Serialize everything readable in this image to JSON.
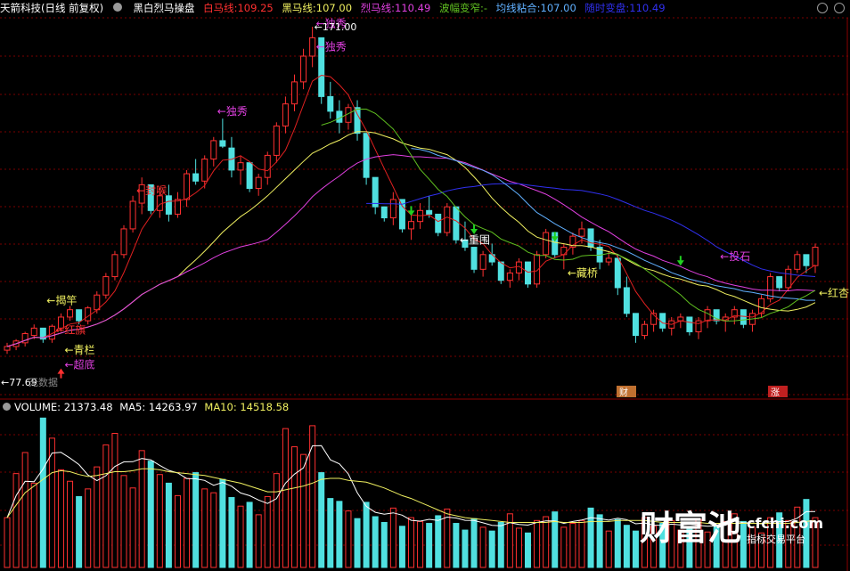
{
  "header": {
    "stock_name": "天箭科技",
    "period": "(日线 前复权)",
    "indicator_name": "黑白烈马操盘",
    "white_horse": {
      "label": "白马线:",
      "value": "109.25"
    },
    "black_horse": {
      "label": "黑马线:",
      "value": "107.00"
    },
    "fierce_horse": {
      "label": "烈马线:",
      "value": "110.49"
    },
    "volatility": {
      "label": "波幅变窄:",
      "value": "-"
    },
    "ma_glue": {
      "label": "均线粘合:",
      "value": "107.00"
    },
    "timing": {
      "label": "随时变盘:",
      "value": "110.49"
    }
  },
  "volume_header": {
    "volume": {
      "label": "VOLUME:",
      "value": "21373.48"
    },
    "ma5": {
      "label": "MA5:",
      "value": "14263.97"
    },
    "ma10": {
      "label": "MA10:",
      "value": "14518.58"
    }
  },
  "labels": {
    "high_price": "171.00",
    "low_price": "77.69",
    "no_data": "无数据",
    "sig_dux1": "独秀",
    "sig_dux2": "独秀",
    "sig_dux3": "独秀",
    "sig_fenghou": "封喉",
    "sig_jiegan1": "揭竿",
    "sig_jiegan2": "揭竿",
    "sig_hongqi": "红旗",
    "sig_caobo": "超底",
    "sig_qinglan": "青栏",
    "sig_chongwei": "重围",
    "sig_cangqiao": "藏桥",
    "sig_toushi1": "投石",
    "sig_toushi2": "投石",
    "sig_hongxing": "红杏",
    "badge_cai": "财",
    "badge_zhang": "涨"
  },
  "watermark": {
    "brand": "财富池",
    "url": "cfchi.com",
    "tagline": "指标交易平台"
  },
  "colors": {
    "bg": "#000000",
    "up": "#ff3030",
    "down": "#50e0e0",
    "ma_red": "#e02020",
    "ma_yellow": "#f0f060",
    "ma_magenta": "#e040e0",
    "ma_blue": "#3030f0",
    "ma_lightblue": "#60b0ff",
    "ma_green": "#60c020",
    "vol_ma5": "#ffffff",
    "vol_ma10": "#f0f060"
  },
  "chart_data": {
    "type": "candlestick",
    "price_high": 171.0,
    "price_low": 77.69,
    "candles": [
      [
        83,
        85,
        82,
        84
      ],
      [
        84,
        86,
        83,
        85.5
      ],
      [
        85,
        88,
        84,
        87.5
      ],
      [
        87,
        90,
        86,
        89
      ],
      [
        89,
        88,
        85,
        86
      ],
      [
        86,
        90,
        85,
        89.5
      ],
      [
        89,
        93,
        88,
        92
      ],
      [
        92,
        95,
        91,
        94
      ],
      [
        94,
        93,
        90,
        91
      ],
      [
        91,
        95,
        90,
        94.5
      ],
      [
        94,
        99,
        93,
        98
      ],
      [
        98,
        104,
        97,
        103
      ],
      [
        103,
        110,
        102,
        109
      ],
      [
        109,
        117,
        108,
        116
      ],
      [
        116,
        125,
        115,
        123.5
      ],
      [
        123,
        130,
        120,
        128
      ],
      [
        128,
        127,
        120,
        121
      ],
      [
        121,
        126,
        119,
        125
      ],
      [
        125,
        128,
        118,
        120
      ],
      [
        120,
        126,
        119,
        124
      ],
      [
        124,
        132,
        122,
        131
      ],
      [
        131,
        135,
        128,
        129
      ],
      [
        129,
        136,
        127,
        135
      ],
      [
        135,
        141,
        133,
        140
      ],
      [
        140,
        146,
        138,
        138.5
      ],
      [
        138,
        141,
        130,
        132
      ],
      [
        132,
        136,
        128,
        134
      ],
      [
        134,
        133,
        126,
        127
      ],
      [
        127,
        131,
        125,
        130
      ],
      [
        130,
        137,
        128,
        136
      ],
      [
        136,
        145,
        134,
        144
      ],
      [
        144,
        152,
        142,
        150
      ],
      [
        150,
        158,
        148,
        156
      ],
      [
        156,
        165,
        154,
        163
      ],
      [
        163,
        171,
        160,
        168
      ],
      [
        168,
        165,
        150,
        152
      ],
      [
        152,
        156,
        146,
        148
      ],
      [
        148,
        151,
        142,
        145
      ],
      [
        145,
        150,
        143,
        149
      ],
      [
        149,
        151,
        140,
        142
      ],
      [
        142,
        140,
        128,
        130
      ],
      [
        130,
        128,
        120,
        122
      ],
      [
        122,
        121,
        118,
        119
      ],
      [
        119,
        126,
        117,
        124
      ],
      [
        124,
        123,
        115,
        116
      ],
      [
        116,
        120,
        113,
        118
      ],
      [
        118,
        123,
        116,
        121
      ],
      [
        121,
        125,
        119,
        120
      ],
      [
        120,
        119,
        114,
        115
      ],
      [
        115,
        123,
        114,
        122
      ],
      [
        122,
        121,
        112,
        113
      ],
      [
        113,
        118,
        110,
        111
      ],
      [
        111,
        108,
        104,
        105
      ],
      [
        105,
        110,
        103,
        109
      ],
      [
        109,
        112,
        106,
        107
      ],
      [
        107,
        106,
        101,
        102
      ],
      [
        102,
        105,
        100,
        104
      ],
      [
        104,
        108,
        102,
        107
      ],
      [
        107,
        106,
        100,
        101
      ],
      [
        101,
        110,
        100,
        109
      ],
      [
        109,
        116,
        108,
        115
      ],
      [
        115,
        114,
        108,
        109
      ],
      [
        109,
        112,
        105,
        111
      ],
      [
        111,
        115,
        109,
        114
      ],
      [
        114,
        118,
        112,
        116
      ],
      [
        116,
        115,
        110,
        111
      ],
      [
        111,
        113,
        105,
        107
      ],
      [
        107,
        110,
        106,
        108
      ],
      [
        108,
        109,
        98,
        100
      ],
      [
        100,
        103,
        92,
        93
      ],
      [
        93,
        92,
        85,
        87
      ],
      [
        87,
        91,
        86,
        90
      ],
      [
        90,
        94,
        88,
        93
      ],
      [
        93,
        92,
        88,
        89
      ],
      [
        89,
        92,
        87,
        91
      ],
      [
        91,
        93,
        89,
        92
      ],
      [
        92,
        91,
        87,
        88
      ],
      [
        88,
        92,
        86,
        91
      ],
      [
        91,
        95,
        89,
        94
      ],
      [
        94,
        93,
        90,
        91
      ],
      [
        91,
        93,
        88,
        92
      ],
      [
        92,
        95,
        90,
        94
      ],
      [
        94,
        93,
        89,
        90
      ],
      [
        90,
        94,
        88,
        93
      ],
      [
        93,
        98,
        92,
        97
      ],
      [
        97,
        104,
        96,
        103
      ],
      [
        103,
        102,
        99,
        100
      ],
      [
        100,
        106,
        99,
        105
      ],
      [
        105,
        110,
        104,
        109
      ],
      [
        109,
        108,
        104,
        106
      ],
      [
        106,
        112,
        104,
        111
      ]
    ],
    "volume": [
      5200,
      9800,
      12000,
      8800,
      15600,
      13500,
      10200,
      9000,
      7400,
      8200,
      10500,
      12800,
      14000,
      9600,
      8300,
      12200,
      11100,
      9700,
      8800,
      7500,
      9300,
      9900,
      8200,
      7800,
      9200,
      7300,
      6400,
      6800,
      5500,
      7400,
      9800,
      14500,
      12600,
      11800,
      14800,
      9900,
      7200,
      6900,
      5900,
      5100,
      6800,
      5300,
      4700,
      6200,
      4300,
      5200,
      4800,
      4600,
      5400,
      6100,
      4600,
      3900,
      5100,
      4200,
      3800,
      4700,
      5600,
      4100,
      3600,
      4900,
      5300,
      5800,
      4200,
      4600,
      4900,
      6200,
      5500,
      3800,
      5000,
      4400,
      3800,
      5200,
      4300,
      4600,
      4900,
      3900,
      4200,
      5000,
      3700,
      4300,
      4800,
      5600,
      4800,
      4200,
      3600,
      5200,
      5700,
      4900,
      6300,
      7100,
      5200
    ],
    "vol_ma5": [
      5200,
      7500,
      9000,
      8950,
      10280,
      11940,
      12020,
      11420,
      10740,
      9660,
      9060,
      9580,
      10540,
      11020,
      11040,
      11380,
      11240,
      10660,
      10140,
      9860,
      9280,
      9260,
      9090,
      8580,
      8880,
      8480,
      7780,
      7500,
      7040,
      6680,
      7180,
      8800,
      9740,
      10400,
      12700,
      12720,
      11240,
      10820,
      9760,
      7800,
      6380,
      5760,
      5560,
      5700,
      5460,
      4920,
      4840,
      5020,
      4900,
      5260,
      5160,
      4920,
      4900,
      4660,
      4400,
      4340,
      4680,
      4480,
      4420,
      4700,
      4860,
      4860,
      4600,
      4800,
      4960,
      5200,
      5100,
      4940,
      5140,
      5000,
      4560,
      4640,
      4420,
      4400,
      4520,
      4440,
      4500,
      4400,
      4300,
      4340,
      4400,
      4840,
      4680,
      4620,
      4560,
      4760,
      4780,
      4800,
      5140,
      5820,
      5840
    ],
    "vol_ma10": [
      5200,
      6500,
      7800,
      8500,
      9200,
      9900,
      10100,
      10000,
      9700,
      9500,
      9600,
      9800,
      10000,
      10000,
      10100,
      10300,
      10300,
      10200,
      10000,
      9900,
      9800,
      9700,
      9600,
      9400,
      9200,
      9000,
      8800,
      8500,
      8200,
      7900,
      7900,
      8100,
      8300,
      8500,
      8800,
      9200,
      9300,
      9300,
      9100,
      9000,
      8900,
      8600,
      8300,
      7900,
      7500,
      7200,
      6800,
      6400,
      6000,
      5600,
      5400,
      5200,
      5100,
      5000,
      4900,
      4800,
      4700,
      4700,
      4700,
      4700,
      4700,
      4800,
      4700,
      4700,
      4700,
      4800,
      4800,
      4800,
      4900,
      4900,
      4900,
      4900,
      4800,
      4700,
      4700,
      4700,
      4700,
      4700,
      4600,
      4600,
      4600,
      4600,
      4600,
      4600,
      4600,
      4600,
      4600,
      4600,
      4700,
      4800,
      4900
    ]
  }
}
